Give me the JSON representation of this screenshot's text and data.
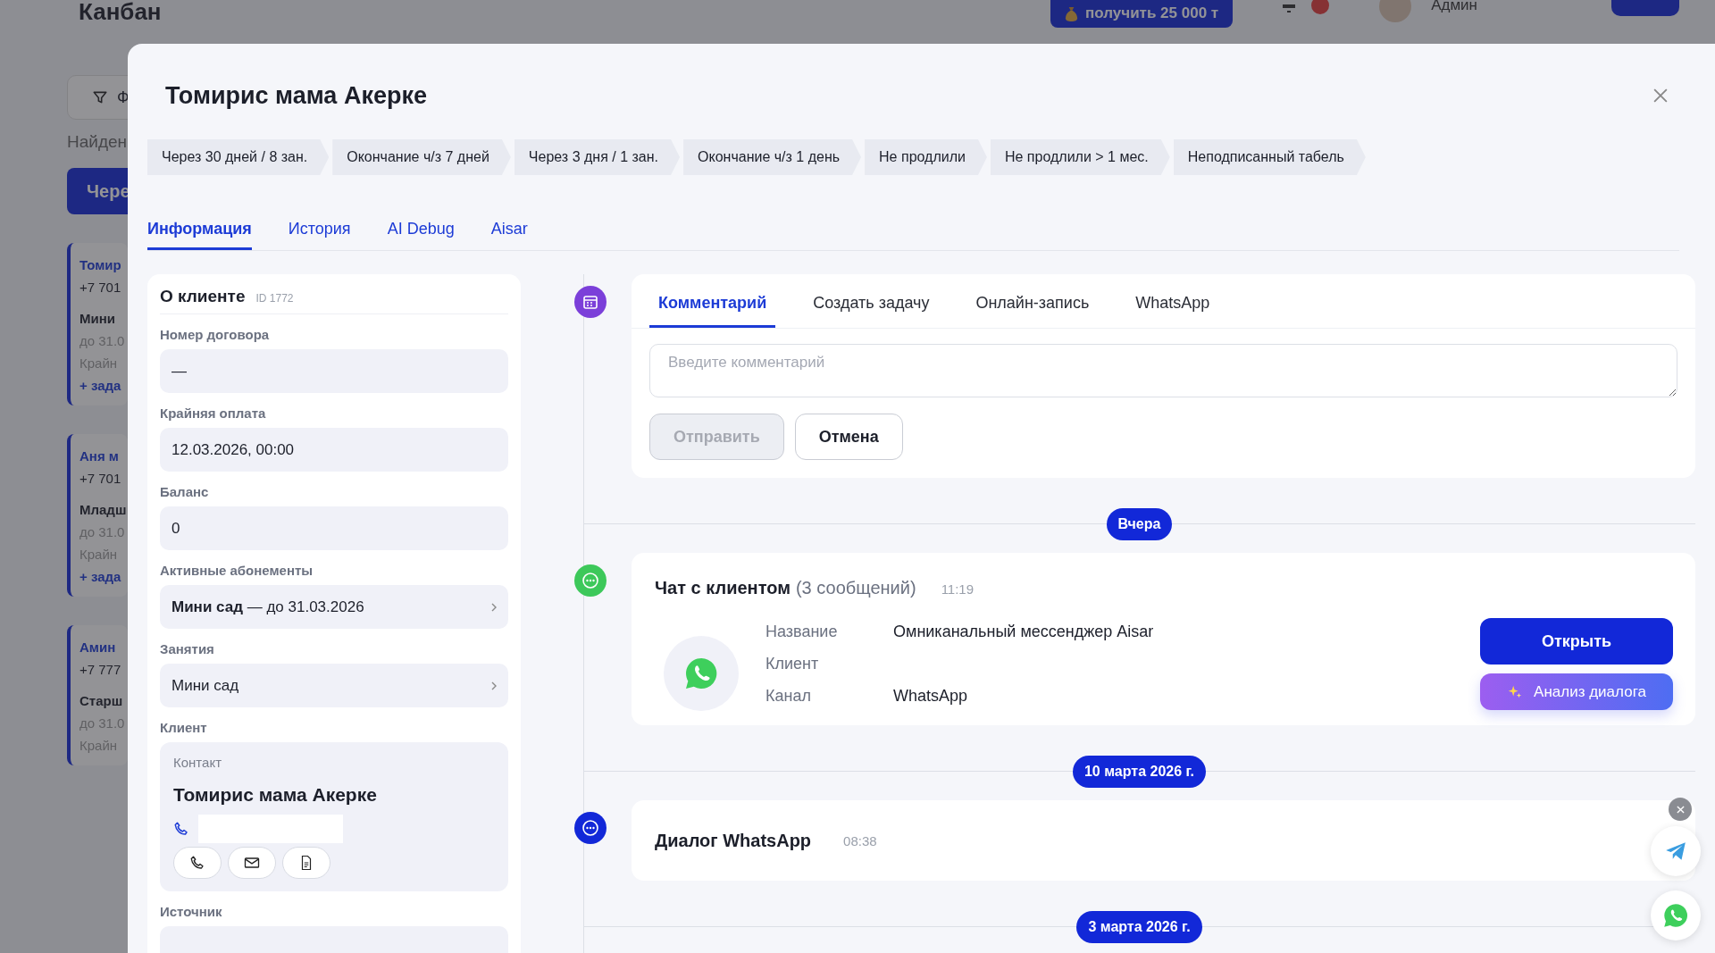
{
  "background": {
    "page_title": "Канбан",
    "promo_button": "получить 25 000 т",
    "user_name": "Админ",
    "filter_label": "Ф",
    "found_text": "Найден",
    "stage_button": "Чере",
    "cards": [
      {
        "name": "Томир",
        "phone": "+7 701",
        "plan": "Мини",
        "until": "до 31.0",
        "due": "Крайн",
        "add_task": "+ зада"
      },
      {
        "name": "Аня м",
        "phone": "+7 701",
        "plan": "Младш",
        "until": "до 31.0",
        "due": "Крайн",
        "add_task": "+ зада"
      },
      {
        "name": "Амин",
        "phone": "+7 777",
        "plan": "Старш",
        "until": "до 31.0",
        "due": "Крайн"
      }
    ]
  },
  "modal": {
    "title": "Томирис мама Акерке"
  },
  "stages": [
    {
      "label": "Через 30 дней / 8 зан."
    },
    {
      "label": "Окончание ч/з 7 дней"
    },
    {
      "label": "Через 3 дня / 1 зан."
    },
    {
      "label": "Окончание ч/з 1 день"
    },
    {
      "label": "Не продлили"
    },
    {
      "label": "Не продлили > 1 мес."
    },
    {
      "label": "Неподписанный табель"
    }
  ],
  "tabs": [
    {
      "label": "Информация",
      "selected": true
    },
    {
      "label": "История",
      "selected": false
    },
    {
      "label": "AI Debug",
      "selected": false
    },
    {
      "label": "Aisar",
      "selected": false
    }
  ],
  "client": {
    "heading": "О клиенте",
    "id": "ID 1772",
    "fields": [
      {
        "kind": "text",
        "label": "Номер договора",
        "value": "—"
      },
      {
        "kind": "text",
        "label": "Крайняя оплата",
        "value": "12.03.2026, 00:00"
      },
      {
        "kind": "text",
        "label": "Баланс",
        "value": "0"
      },
      {
        "kind": "link",
        "label": "Активные абонементы",
        "value": "**Мини сад** — до 31.03.2026"
      },
      {
        "kind": "link",
        "label": "Занятия",
        "value": "Мини сад"
      }
    ],
    "client_label": "Клиент",
    "contact": {
      "label": "Контакт",
      "name": "Томирис мама Акерке"
    },
    "source_label": "Источник"
  },
  "composer": {
    "tabs": [
      {
        "label": "Комментарий",
        "selected": true
      },
      {
        "label": "Создать задачу",
        "selected": false
      },
      {
        "label": "Онлайн-запись",
        "selected": false
      },
      {
        "label": "WhatsApp",
        "selected": false
      }
    ],
    "placeholder": "Введите комментарий",
    "send": "Отправить",
    "send_disabled": true,
    "cancel": "Отмена"
  },
  "timeline": [
    {
      "kind": "date",
      "label": "Вчера"
    },
    {
      "kind": "chat",
      "title": "Чат с клиентом",
      "count": "(3 сообщений)",
      "time": "11:19",
      "rows": [
        {
          "label": "Название",
          "value": "Омниканальный мессенджер Aisar"
        },
        {
          "label": "Клиент"
        },
        {
          "label": "Канал",
          "value": "WhatsApp"
        }
      ],
      "open": "Открыть",
      "analyze": "Анализ диалога"
    },
    {
      "kind": "date",
      "label": "10 марта 2026 г."
    },
    {
      "kind": "dialog",
      "title": "Диалог WhatsApp",
      "time": "08:38"
    },
    {
      "kind": "date",
      "label": "3 марта 2026 г."
    }
  ]
}
